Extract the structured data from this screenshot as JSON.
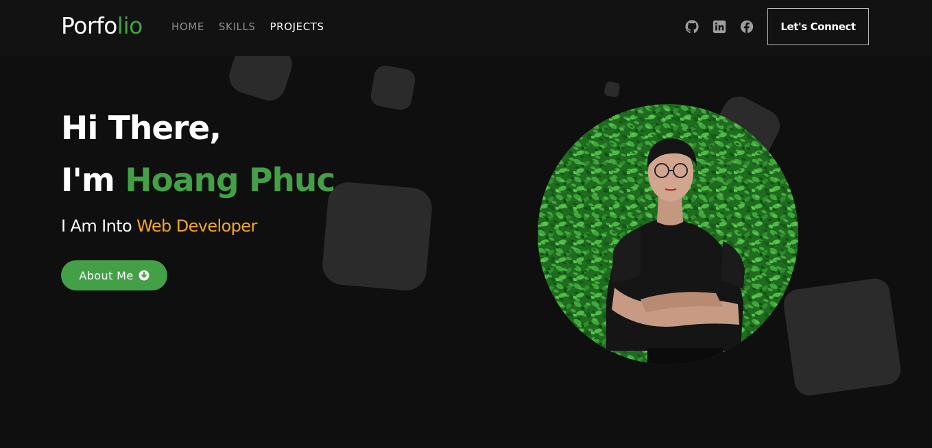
{
  "navbar": {
    "logo_part1": "Porfo",
    "logo_part2": "lio",
    "links": [
      {
        "label": "HOME",
        "active": false
      },
      {
        "label": "SKILLS",
        "active": false
      },
      {
        "label": "PROJECTS",
        "active": true
      }
    ],
    "social_icons": [
      "github-icon",
      "linkedin-icon",
      "facebook-icon"
    ],
    "connect_label": "Let's Connect"
  },
  "hero": {
    "greeting": "Hi There,",
    "intro_prefix": "I'm ",
    "name": "Hoang Phuc",
    "sub_prefix": "I Am Into ",
    "role": "Web Developer",
    "about_label": "About Me",
    "about_icon": "arrow-circle-down-icon"
  },
  "colors": {
    "background": "#0f0f0f",
    "navbar": "#121212",
    "accent_green": "#43a047",
    "accent_orange": "#f5a623",
    "decor_square": "#2b2b2b"
  }
}
